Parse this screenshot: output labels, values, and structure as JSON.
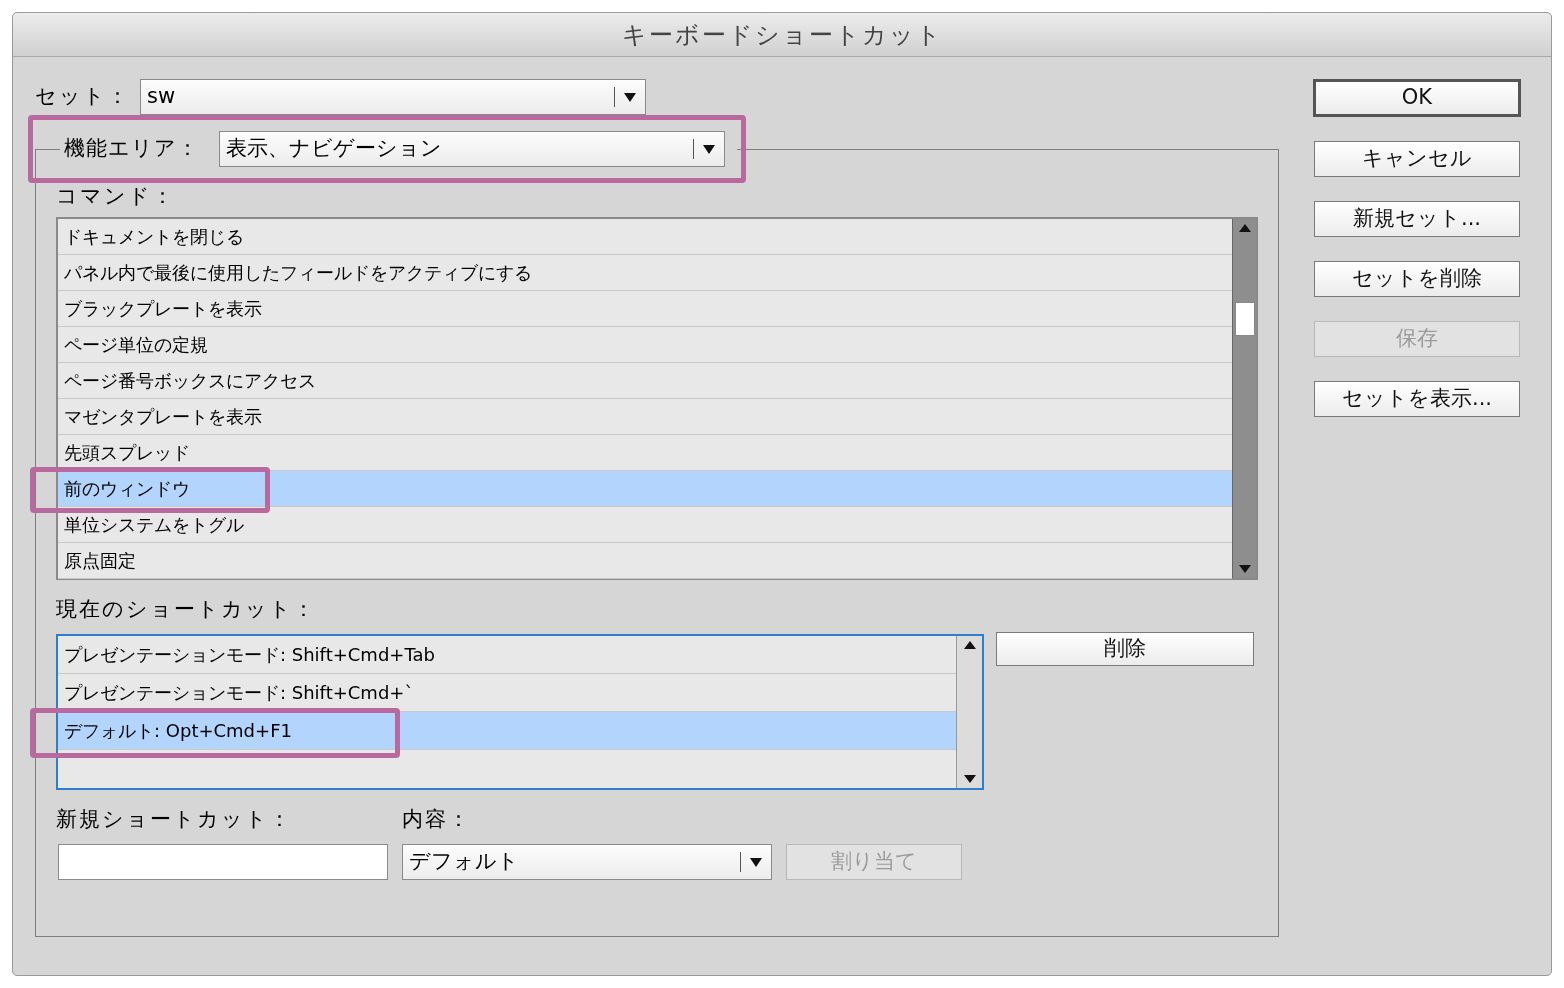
{
  "window": {
    "title": "キーボードショートカット"
  },
  "set": {
    "label": "セット：",
    "value": "sw"
  },
  "feature_area": {
    "label": "機能エリア：",
    "value": "表示、ナビゲーション",
    "highlighted": true
  },
  "commands": {
    "label": "コマンド：",
    "items": [
      {
        "text": "ドキュメントを閉じる",
        "selected": false,
        "highlighted": false
      },
      {
        "text": "パネル内で最後に使用したフィールドをアクティブにする",
        "selected": false,
        "highlighted": false
      },
      {
        "text": "ブラックプレートを表示",
        "selected": false,
        "highlighted": false
      },
      {
        "text": "ページ単位の定規",
        "selected": false,
        "highlighted": false
      },
      {
        "text": "ページ番号ボックスにアクセス",
        "selected": false,
        "highlighted": false
      },
      {
        "text": "マゼンタプレートを表示",
        "selected": false,
        "highlighted": false
      },
      {
        "text": "先頭スプレッド",
        "selected": false,
        "highlighted": false
      },
      {
        "text": "前のウィンドウ",
        "selected": true,
        "highlighted": true
      },
      {
        "text": "単位システムをトグル",
        "selected": false,
        "highlighted": false
      },
      {
        "text": "原点固定",
        "selected": false,
        "highlighted": false
      }
    ]
  },
  "current_shortcuts": {
    "label": "現在のショートカット：",
    "items": [
      {
        "text": "プレゼンテーションモード: Shift+Cmd+Tab",
        "selected": false,
        "highlighted": false
      },
      {
        "text": "プレゼンテーションモード: Shift+Cmd+`",
        "selected": false,
        "highlighted": false
      },
      {
        "text": "デフォルト: Opt+Cmd+F1",
        "selected": true,
        "highlighted": true
      }
    ],
    "delete_button": {
      "label": "削除",
      "disabled": false
    }
  },
  "new_shortcut": {
    "label": "新規ショートカット："
  },
  "context": {
    "label": "内容：",
    "value": "デフォルト"
  },
  "assign_button": {
    "label": "割り当て",
    "disabled": true
  },
  "buttons": [
    {
      "label": "OK",
      "default": true,
      "disabled": false
    },
    {
      "label": "キャンセル",
      "default": false,
      "disabled": false
    },
    {
      "label": "新規セット...",
      "default": false,
      "disabled": false
    },
    {
      "label": "セットを削除",
      "default": false,
      "disabled": false
    },
    {
      "label": "保存",
      "default": false,
      "disabled": true
    },
    {
      "label": "セットを表示...",
      "default": false,
      "disabled": false
    }
  ]
}
